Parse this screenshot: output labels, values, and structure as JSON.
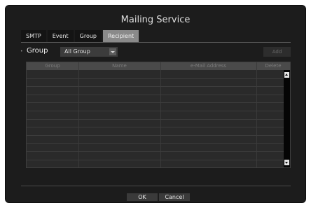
{
  "dialog": {
    "title": "Mailing Service"
  },
  "tabs": [
    {
      "label": "SMTP",
      "active": false
    },
    {
      "label": "Event",
      "active": false
    },
    {
      "label": "Group",
      "active": false
    },
    {
      "label": "Recipient",
      "active": true
    }
  ],
  "group": {
    "label": "Group",
    "selected": "All Group",
    "add_label": "Add"
  },
  "table": {
    "columns": [
      "Group",
      "Name",
      "e-Mail Address",
      "Delete"
    ],
    "row_count": 12
  },
  "footer": {
    "ok_label": "OK",
    "cancel_label": "Cancel"
  },
  "colors": {
    "dialog_bg": "#1c1c1c",
    "active_tab": "#8a8a8a",
    "header_bg": "#4a4a4a"
  }
}
